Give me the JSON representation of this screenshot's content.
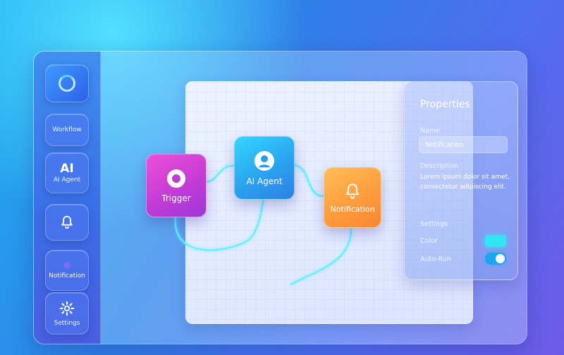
{
  "sidebar": {
    "items": [
      {
        "id": "workflow",
        "label": "Workflow"
      },
      {
        "id": "ai-agent",
        "label": "AI Agent",
        "big": "AI"
      },
      {
        "id": "alert",
        "label": ""
      },
      {
        "id": "notification",
        "label": "Notification"
      },
      {
        "id": "settings",
        "label": "Settings"
      }
    ]
  },
  "nodes": {
    "trigger": {
      "label": "Trigger"
    },
    "agent": {
      "label": "AI Agent"
    },
    "notification": {
      "label": "Notification"
    }
  },
  "properties": {
    "title": "Properties",
    "name_label": "Name",
    "name_value": "Notification",
    "description_label": "Description",
    "description_value": "Lorem ipsum dolor sit amet, consectetur adipiscing elit.",
    "settings_label": "Settings",
    "color_label": "Color",
    "color_value": "#2fe6f2",
    "autorun_label": "Auto-Run",
    "autorun_enabled": true
  },
  "colors": {
    "trigger": "#d63fd6",
    "agent": "#2ab0f2",
    "notification": "#ff9e40",
    "wire": "#5ff0ff"
  },
  "icons": {
    "logo": "ring-logo-icon",
    "alert": "bell-icon",
    "settings": "gear-icon",
    "trigger": "record-icon",
    "agent": "user-icon",
    "notification": "bell-icon"
  }
}
